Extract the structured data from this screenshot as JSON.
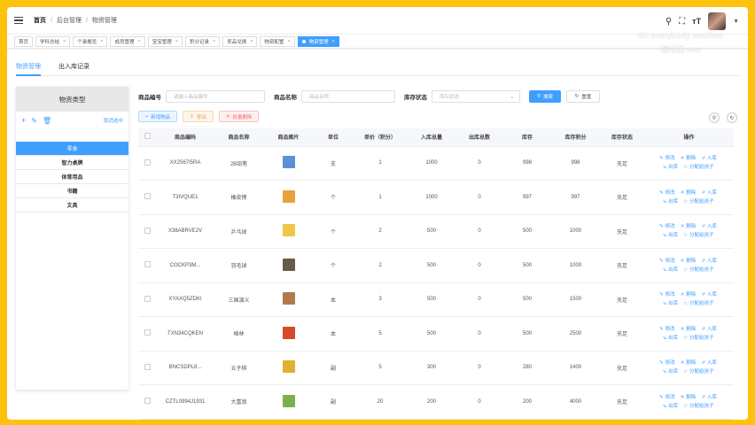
{
  "header": {
    "breadcrumb": [
      "首页",
      "后台管理",
      "物资管理"
    ],
    "watermark_line1": "So everybody woohoo",
    "watermark_line2": "有时候 mm"
  },
  "tags": [
    {
      "label": "首页",
      "active": false
    },
    {
      "label": "学科总结",
      "active": false
    },
    {
      "label": "个录概览",
      "active": false
    },
    {
      "label": "成员管理",
      "active": false
    },
    {
      "label": "宝宝管理",
      "active": false
    },
    {
      "label": "积分记录",
      "active": false
    },
    {
      "label": "奖品兑换",
      "active": false
    },
    {
      "label": "物资配置",
      "active": false
    },
    {
      "label": "物资管理",
      "active": true
    }
  ],
  "subtabs": [
    "物资管理",
    "出入库记录"
  ],
  "leftpanel": {
    "title": "物资类型",
    "reset": "取消选中",
    "items": [
      "零食",
      "智力桌牌",
      "体育用品",
      "书籍",
      "文具"
    ],
    "selected_index": 0
  },
  "filters": {
    "code_label": "商品编号",
    "code_placeholder": "请输入商品编号",
    "name_label": "商品名称",
    "name_placeholder": "商品名称",
    "status_label": "库存状态",
    "status_placeholder": "库存状态",
    "search_btn": "搜索",
    "reset_btn": "重置"
  },
  "actions": {
    "add": "新增物品",
    "export": "导出",
    "batch_delete": "批量删除"
  },
  "table": {
    "columns": [
      "商品编码",
      "商品名称",
      "商品图片",
      "单位",
      "单价（积分）",
      "入库总量",
      "出库总数",
      "库存",
      "库存积分",
      "库存状态",
      "操作"
    ],
    "ops": {
      "edit": "修改",
      "delete": "删除",
      "in": "入库",
      "out": "出库",
      "assign": "分配给孩子"
    },
    "rows": [
      {
        "code": "XX2567I5RA",
        "name": "2B铅笔",
        "unit": "支",
        "price": "1",
        "in_total": "1000",
        "out_total": "0",
        "stock": "998",
        "stock_points": "998",
        "status": "充足",
        "thumb": "#5b8fd8"
      },
      {
        "code": "T3IVQUE1",
        "name": "橡皮擦",
        "unit": "个",
        "price": "1",
        "in_total": "1000",
        "out_total": "0",
        "stock": "997",
        "stock_points": "997",
        "status": "充足",
        "thumb": "#e9a23b"
      },
      {
        "code": "X38ABRVE2V",
        "name": "乒乓球",
        "unit": "个",
        "price": "2",
        "in_total": "500",
        "out_total": "0",
        "stock": "500",
        "stock_points": "1000",
        "status": "充足",
        "thumb": "#f0c64a"
      },
      {
        "code": "COCKP3M...",
        "name": "羽毛球",
        "unit": "个",
        "price": "2",
        "in_total": "500",
        "out_total": "0",
        "stock": "500",
        "stock_points": "1000",
        "status": "充足",
        "thumb": "#6a5a4a"
      },
      {
        "code": "XYAXQ5ZDKI",
        "name": "三国演义",
        "unit": "本",
        "price": "3",
        "in_total": "500",
        "out_total": "0",
        "stock": "500",
        "stock_points": "1500",
        "status": "充足",
        "thumb": "#b07a4a"
      },
      {
        "code": "TXN34CQKEN",
        "name": "格林",
        "unit": "本",
        "price": "5",
        "in_total": "500",
        "out_total": "0",
        "stock": "500",
        "stock_points": "2500",
        "status": "充足",
        "thumb": "#d44a2a"
      },
      {
        "code": "BNCSDPL8...",
        "name": "五子棋",
        "unit": "副",
        "price": "5",
        "in_total": "300",
        "out_total": "0",
        "stock": "280",
        "stock_points": "1400",
        "status": "充足",
        "thumb": "#e0b030"
      },
      {
        "code": "CZTL0994J1931",
        "name": "大富翁",
        "unit": "副",
        "price": "20",
        "in_total": "200",
        "out_total": "0",
        "stock": "200",
        "stock_points": "4000",
        "status": "充足",
        "thumb": "#7ab04a"
      }
    ]
  }
}
